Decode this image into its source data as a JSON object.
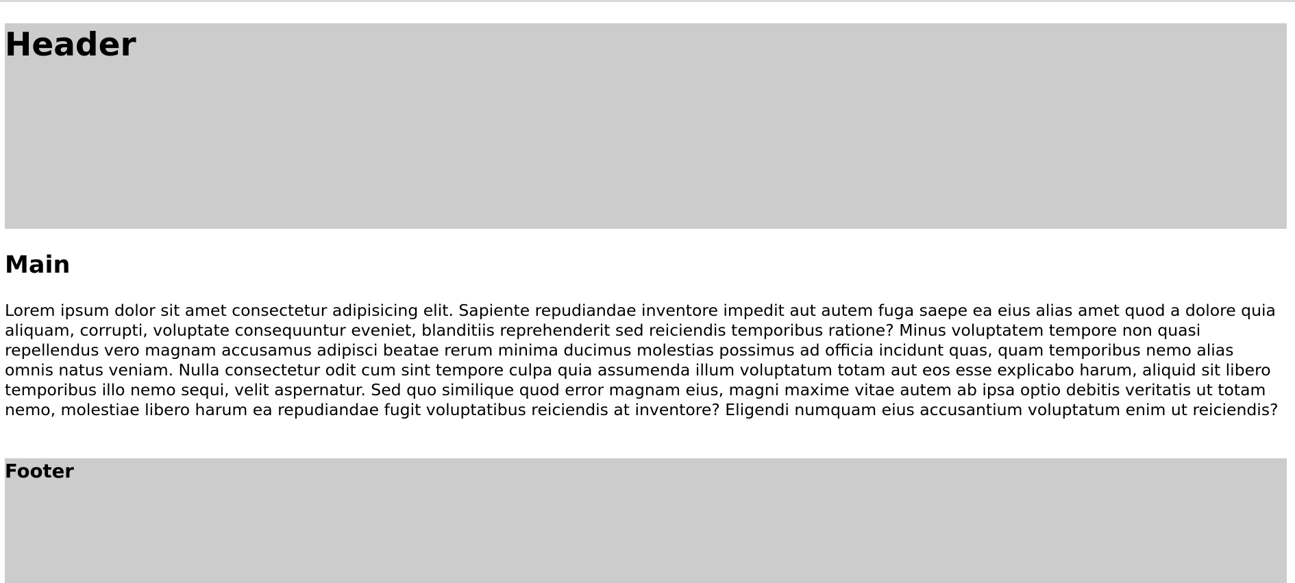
{
  "header": {
    "title": "Header"
  },
  "main": {
    "title": "Main",
    "paragraph": "Lorem ipsum dolor sit amet consectetur adipisicing elit. Sapiente repudiandae inventore impedit aut autem fuga saepe ea eius alias amet quod a dolore quia aliquam, corrupti, voluptate consequuntur eveniet, blanditiis reprehenderit sed reiciendis temporibus ratione? Minus voluptatem tempore non quasi repellendus vero magnam accusamus adipisci beatae rerum minima ducimus molestias possimus ad officia incidunt quas, quam temporibus nemo alias omnis natus veniam. Nulla consectetur odit cum sint tempore culpa quia assumenda illum voluptatum totam aut eos esse explicabo harum, aliquid sit libero temporibus illo nemo sequi, velit aspernatur. Sed quo similique quod error magnam eius, magni maxime vitae autem ab ipsa optio debitis veritatis ut totam nemo, molestiae libero harum ea repudiandae fugit voluptatibus reiciendis at inventore? Eligendi numquam eius accusantium voluptatum enim ut reiciendis?"
  },
  "footer": {
    "title": "Footer"
  },
  "colors": {
    "section_background": "#cccccc",
    "page_background": "#ffffff",
    "text": "#000000"
  }
}
